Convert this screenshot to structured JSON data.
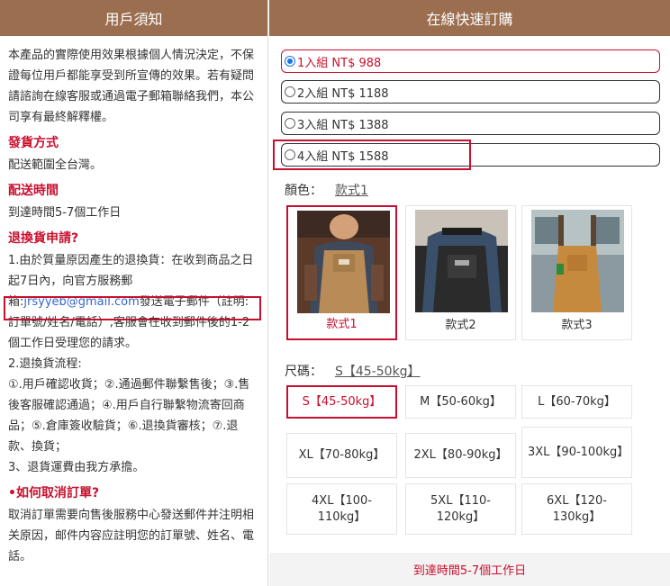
{
  "left": {
    "header": "用戶須知",
    "intro": "本產品的實際使用效果根據個人情況決定，不保證每位用戶都能享受到所宣傳的效果。若有疑問請諮詢在線客服或通過電子郵箱聯絡我們，本公司享有最終解釋權。",
    "shipping_title": "發貨方式",
    "shipping_text": "配送範圍全台灣。",
    "delivery_title": "配送時間",
    "delivery_text": "到達時間5-7個工作日",
    "return_title": "退換貨申請?",
    "return_p1_a": "1.由於質量原因產生的退換貨：在收到商品之日起7日內，向官方服務郵",
    "return_p1_b": "箱:",
    "return_email": "jrsyyeb@gmail.com",
    "return_p1_c": "發送電子郵件（註明:",
    "return_p1_d": "訂單號/姓名/電話）,客服會在收到郵件後的1-2個工作日受理您的請求。",
    "return_p2": "2.退換貨流程:",
    "return_p2_steps": "①.用戶確認收貨；②.通過郵件聯繫售後；③.售後客服確認通過；④.用戶自行聯繫物流寄回商品；⑤.倉庫簽收驗貨；⑥.退換貨審核；⑦.退款、換貨；",
    "return_p3": "3、退貨運費由我方承擔。",
    "cancel_title": "•如何取消訂單?",
    "cancel_text": "取消訂單需要向售後服務中心發送郵件并注明相关原因，邮件内容应註明您的訂單號、姓名、電話。"
  },
  "right": {
    "header": "在線快速訂購",
    "options": [
      {
        "label": "1入組 NT$ 988",
        "selected": true
      },
      {
        "label": "2入組 NT$ 1188",
        "selected": false
      },
      {
        "label": "3入組 NT$ 1388",
        "selected": false
      },
      {
        "label": "4入組 NT$ 1588",
        "selected": false
      }
    ],
    "color_label": "顏色：",
    "color_value": "款式1",
    "colors": [
      {
        "label": "款式1",
        "selected": true
      },
      {
        "label": "款式2",
        "selected": false
      },
      {
        "label": "款式3",
        "selected": false
      }
    ],
    "size_label": "尺碼：",
    "size_value": "S【45-50kg】",
    "sizes": [
      {
        "label": "S【45-50kg】",
        "selected": true
      },
      {
        "label": "M【50-60kg】",
        "selected": false
      },
      {
        "label": "L【60-70kg】",
        "selected": false
      },
      {
        "label": "XL【70-80kg】",
        "selected": false
      },
      {
        "label": "2XL【80-90kg】",
        "selected": false
      },
      {
        "label": "3XL【90-100kg】",
        "selected": false
      },
      {
        "label": "4XL【100-110kg】",
        "selected": false
      },
      {
        "label": "5XL【110-120kg】",
        "selected": false
      },
      {
        "label": "6XL【120-130kg】",
        "selected": false
      }
    ],
    "footer": "到達時間5-7個工作日"
  },
  "colors": {
    "brand": "#9b6e4f",
    "accent": "#c8102e",
    "radio": "#1a73e8"
  }
}
